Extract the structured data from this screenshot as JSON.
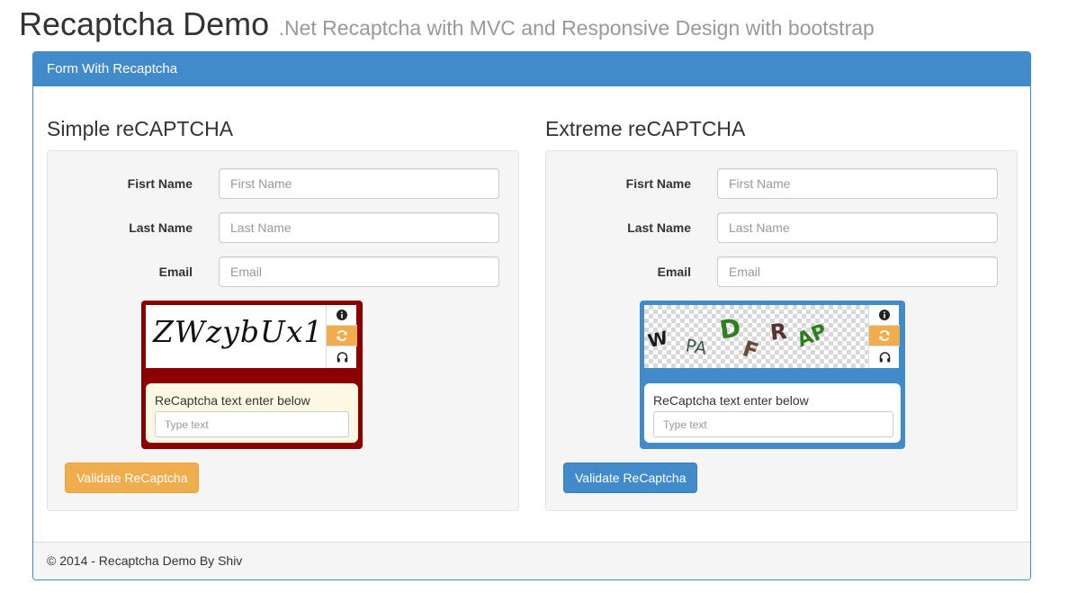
{
  "header": {
    "title": "Recaptcha Demo",
    "subtitle": ".Net Recaptcha with MVC and Responsive Design with bootstrap"
  },
  "panel": {
    "heading": "Form With Recaptcha",
    "footer": "© 2014 - Recaptcha Demo By Shiv"
  },
  "colors": {
    "primary": "#428bca",
    "warning": "#f0ad4e",
    "captcha_dark_red": "#8b0000",
    "entry_yellow": "#fcf8e3"
  },
  "simple": {
    "title": "Simple reCAPTCHA",
    "first_name_label": "Fisrt Name",
    "first_name_placeholder": "First Name",
    "last_name_label": "Last Name",
    "last_name_placeholder": "Last Name",
    "email_label": "Email",
    "email_placeholder": "Email",
    "captcha_text": "ZWzybUx1",
    "captcha_prompt": "ReCaptcha text enter below",
    "captcha_placeholder": "Type text",
    "button": "Validate ReCaptcha",
    "icons": [
      "info-icon",
      "refresh-icon",
      "headphones-icon"
    ]
  },
  "extreme": {
    "title": "Extreme reCAPTCHA",
    "first_name_label": "Fisrt Name",
    "first_name_placeholder": "First Name",
    "last_name_label": "Last Name",
    "last_name_placeholder": "Last Name",
    "email_label": "Email",
    "email_placeholder": "Email",
    "captcha_letters": [
      "W",
      "PA",
      "D",
      "F",
      "R",
      "AP"
    ],
    "captcha_prompt": "ReCaptcha text enter below",
    "captcha_placeholder": "Type text",
    "button": "Validate ReCaptcha",
    "icons": [
      "info-icon",
      "refresh-icon",
      "headphones-icon"
    ]
  }
}
